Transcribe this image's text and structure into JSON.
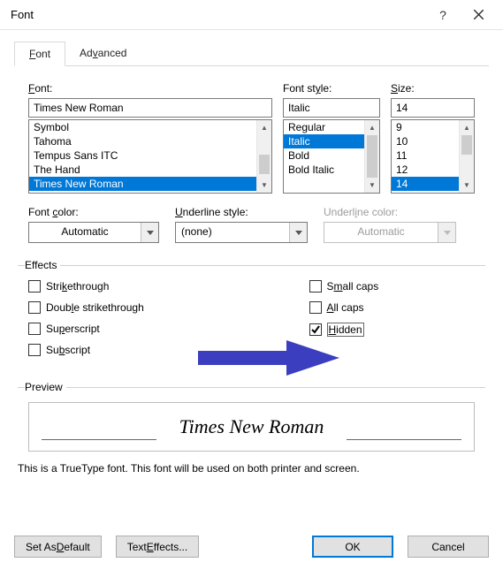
{
  "titlebar": {
    "title": "Font",
    "help": "?",
    "close": "×"
  },
  "tabs": {
    "font": "Font",
    "advanced": "Advanced"
  },
  "labels": {
    "font": "Font:",
    "style": "Font style:",
    "size": "Size:",
    "color": "Font color:",
    "uls": "Underline style:",
    "ulc": "Underline color:"
  },
  "values": {
    "font": "Times New Roman",
    "style": "Italic",
    "size": "14",
    "color": "Automatic",
    "uls": "(none)",
    "ulc": "Automatic"
  },
  "font_list": [
    "Symbol",
    "Tahoma",
    "Tempus Sans ITC",
    "The Hand",
    "Times New Roman"
  ],
  "style_list": [
    "Regular",
    "Italic",
    "Bold",
    "Bold Italic"
  ],
  "size_list": [
    "9",
    "10",
    "11",
    "12",
    "14"
  ],
  "effects": {
    "legend": "Effects",
    "strike": "Strikethrough",
    "dstrike": "Double strikethrough",
    "superscript": "Superscript",
    "subscript": "Subscript",
    "smallcaps": "Small caps",
    "allcaps": "All caps",
    "hidden": "Hidden"
  },
  "preview": {
    "legend": "Preview",
    "text": "Times New Roman",
    "note": "This is a TrueType font. This font will be used on both printer and screen."
  },
  "buttons": {
    "setdefault": "Set As Default",
    "texteffects": "Text Effects...",
    "ok": "OK",
    "cancel": "Cancel"
  }
}
